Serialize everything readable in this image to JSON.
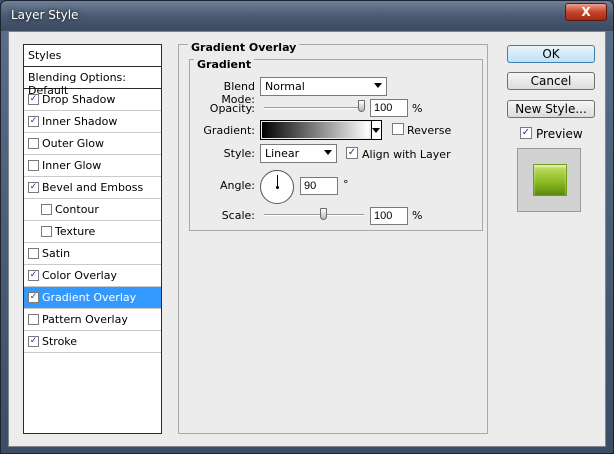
{
  "window": {
    "title": "Layer Style",
    "close_label": "X"
  },
  "stylelist": {
    "header": "Styles",
    "blending": "Blending Options: Default",
    "items": [
      {
        "label": "Drop Shadow",
        "checked": true,
        "sub": false,
        "selected": false
      },
      {
        "label": "Inner Shadow",
        "checked": true,
        "sub": false,
        "selected": false
      },
      {
        "label": "Outer Glow",
        "checked": false,
        "sub": false,
        "selected": false
      },
      {
        "label": "Inner Glow",
        "checked": false,
        "sub": false,
        "selected": false
      },
      {
        "label": "Bevel and Emboss",
        "checked": true,
        "sub": false,
        "selected": false
      },
      {
        "label": "Contour",
        "checked": false,
        "sub": true,
        "selected": false
      },
      {
        "label": "Texture",
        "checked": false,
        "sub": true,
        "selected": false
      },
      {
        "label": "Satin",
        "checked": false,
        "sub": false,
        "selected": false
      },
      {
        "label": "Color Overlay",
        "checked": true,
        "sub": false,
        "selected": false
      },
      {
        "label": "Gradient Overlay",
        "checked": true,
        "sub": false,
        "selected": true
      },
      {
        "label": "Pattern Overlay",
        "checked": false,
        "sub": false,
        "selected": false
      },
      {
        "label": "Stroke",
        "checked": true,
        "sub": false,
        "selected": false
      }
    ]
  },
  "panel": {
    "section_title": "Gradient Overlay",
    "group_title": "Gradient",
    "blend_mode_label": "Blend Mode:",
    "blend_mode_value": "Normal",
    "opacity_label": "Opacity:",
    "opacity_value": "100",
    "opacity_unit": "%",
    "gradient_label": "Gradient:",
    "reverse_label": "Reverse",
    "reverse_checked": false,
    "style_label": "Style:",
    "style_value": "Linear",
    "align_label": "Align with Layer",
    "align_checked": true,
    "angle_label": "Angle:",
    "angle_value": "90",
    "angle_unit": "°",
    "scale_label": "Scale:",
    "scale_value": "100",
    "scale_unit": "%"
  },
  "buttons": {
    "ok": "OK",
    "cancel": "Cancel",
    "new_style": "New Style..."
  },
  "preview": {
    "label": "Preview",
    "checked": true
  },
  "check_glyph": "✓"
}
